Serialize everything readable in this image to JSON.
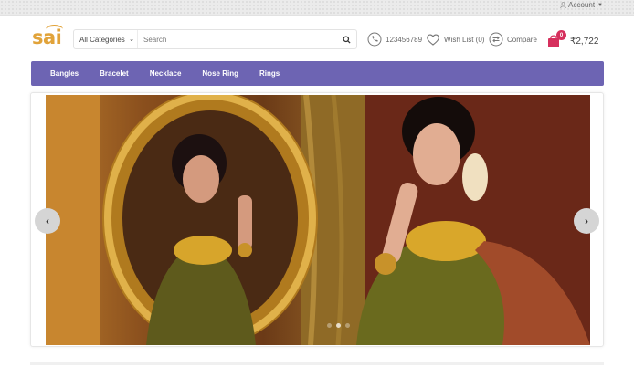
{
  "topbar": {
    "account_label": "Account"
  },
  "header": {
    "logo_text": "sai",
    "search": {
      "category": "All Categories",
      "placeholder": "Search"
    },
    "phone": "123456789",
    "wishlist": "Wish List (0)",
    "compare": "Compare",
    "cart": {
      "count": "0",
      "total": "₹2,722"
    }
  },
  "nav": {
    "items": [
      "Bangles",
      "Bracelet",
      "Necklace",
      "Nose Ring",
      "Rings"
    ]
  },
  "slider": {
    "dots": 3,
    "active_dot": 2
  },
  "colors": {
    "nav_bg": "#6d64b3",
    "logo": "#e1a33a",
    "cart_badge": "#d6305d",
    "cart_icon": "#d6305d"
  }
}
